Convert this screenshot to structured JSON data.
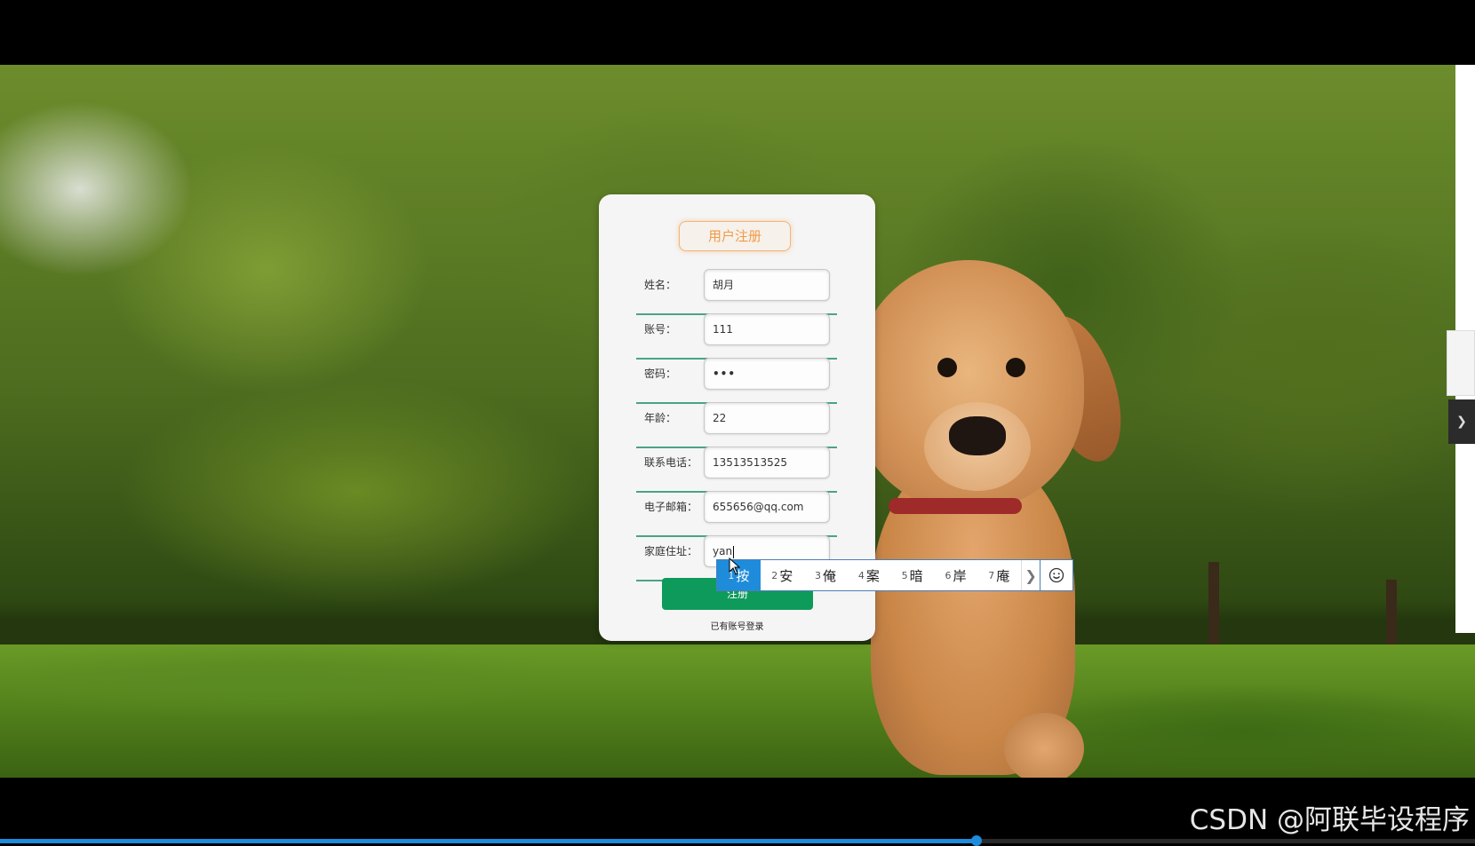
{
  "form": {
    "title": "用户注册",
    "fields": [
      {
        "label": "姓名：",
        "value": "胡月"
      },
      {
        "label": "账号：",
        "value": "111"
      },
      {
        "label": "密码：",
        "value": "•••"
      },
      {
        "label": "年龄：",
        "value": "22"
      },
      {
        "label": "联系电话：",
        "value": "13513513525"
      },
      {
        "label": "电子邮箱：",
        "value": "655656@qq.com"
      },
      {
        "label": "家庭住址：",
        "value": "yan"
      }
    ],
    "submit_label": "注册",
    "login_link": "已有账号登录"
  },
  "ime": {
    "candidates": [
      {
        "num": "1",
        "char": "按"
      },
      {
        "num": "2",
        "char": "安"
      },
      {
        "num": "3",
        "char": "俺"
      },
      {
        "num": "4",
        "char": "案"
      },
      {
        "num": "5",
        "char": "暗"
      },
      {
        "num": "6",
        "char": "岸"
      },
      {
        "num": "7",
        "char": "庵"
      }
    ],
    "more_icon": "chevron-right-icon",
    "emoji_icon": "smiley-icon"
  },
  "watermark": "CSDN @阿联毕设程序",
  "video": {
    "progress": 0.662
  },
  "colors": {
    "accent_green": "#0e9a5b",
    "divider_green": "#4aa387",
    "title_orange": "#f19a49",
    "ime_blue": "#1f8bdb"
  }
}
